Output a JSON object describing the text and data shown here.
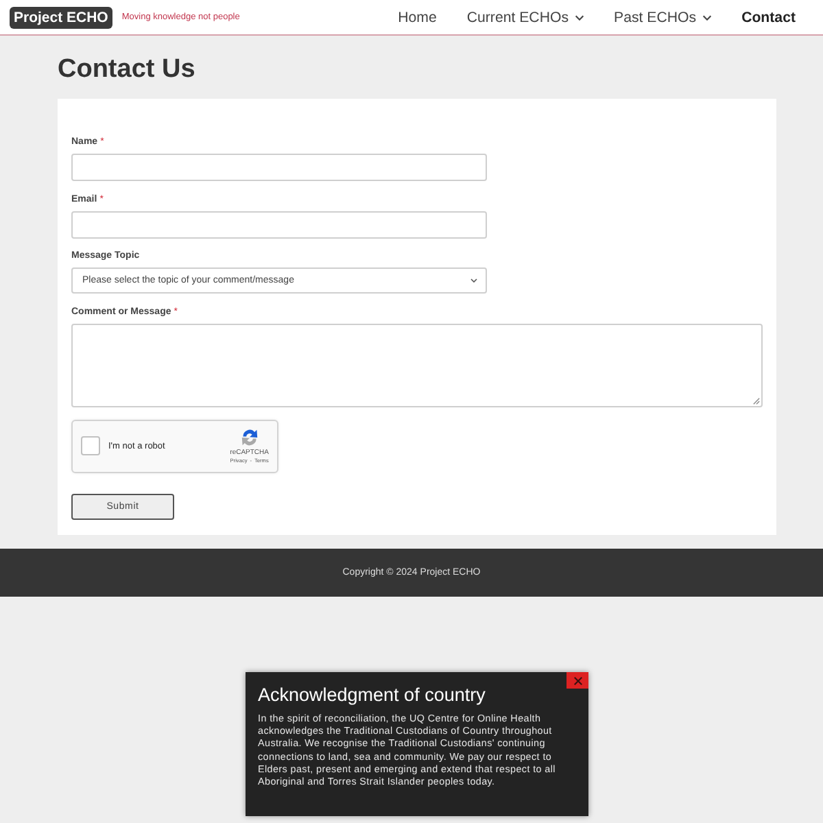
{
  "header": {
    "logo": "Project ECHO",
    "tagline": "Moving knowledge not people",
    "nav": [
      {
        "label": "Home",
        "selected": false,
        "dropdown": false
      },
      {
        "label": "Current ECHOs",
        "selected": false,
        "dropdown": true
      },
      {
        "label": "Past ECHOs",
        "selected": false,
        "dropdown": true
      },
      {
        "label": "Contact",
        "selected": true,
        "dropdown": false
      }
    ]
  },
  "page": {
    "title": "Contact Us"
  },
  "form": {
    "fields": [
      {
        "kind": "text",
        "label": "Name",
        "required_mark": "*"
      },
      {
        "kind": "text",
        "label": "Email",
        "required_mark": "*"
      },
      {
        "kind": "select",
        "label": "Message Topic",
        "value": "Please select the topic of your comment/message"
      },
      {
        "kind": "textarea",
        "label": "Comment or Message",
        "required_mark": "*"
      }
    ],
    "captcha": {
      "label": "I'm not a robot",
      "checked": false,
      "brand": "reCAPTCHA",
      "links": [
        "Privacy",
        "Terms"
      ],
      "separator": "-"
    },
    "submit": "Submit"
  },
  "footer": {
    "copyright": "Copyright © 2024 Project ECHO"
  },
  "popup": {
    "title": "Acknowledgment of country",
    "text": "In the spirit of reconciliation, the UQ Centre for Online Health acknowledges the Traditional Custodians of Country throughout Australia. We recognise the Traditional Custodians' continuing connections to land, sea and community. We pay our respect to Elders past, present and emerging and extend that respect to all Aboriginal and Torres Strait Islander peoples today."
  }
}
